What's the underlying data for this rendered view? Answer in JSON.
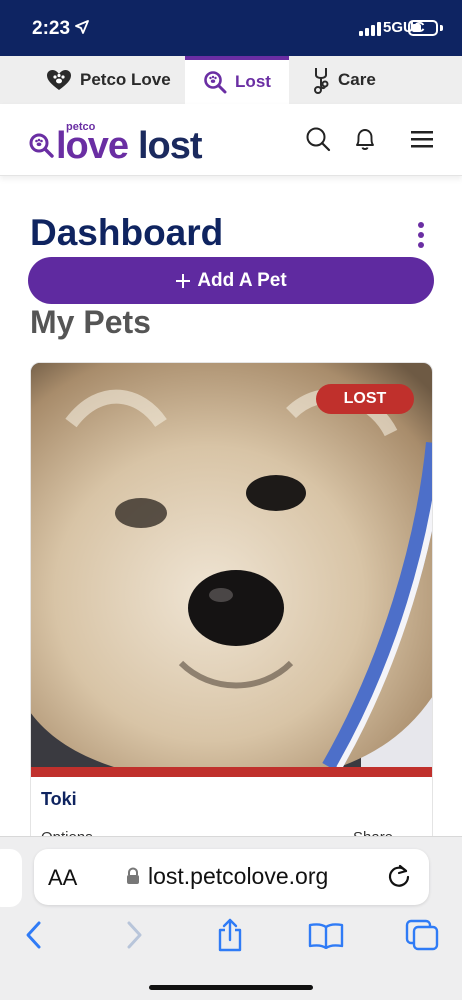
{
  "status_bar": {
    "time": "2:23",
    "network": "5GUC"
  },
  "brand_tabs": [
    {
      "label": "Petco Love",
      "icon": "heart-paw-icon",
      "active": false
    },
    {
      "label": "Lost",
      "icon": "magnifier-paw-icon",
      "active": true
    },
    {
      "label": "Care",
      "icon": "stethoscope-icon",
      "active": false
    }
  ],
  "header": {
    "logo_petco": "petco",
    "logo_love": "love",
    "logo_lost": "lost",
    "icons": [
      "search-icon",
      "bell-icon",
      "menu-icon"
    ]
  },
  "dashboard": {
    "title": "Dashboard",
    "add_pet_label": "Add A Pet",
    "section_title": "My Pets"
  },
  "pets": [
    {
      "name": "Toki",
      "status": "LOST",
      "options_label": "Options",
      "share_label": "Share"
    }
  ],
  "browser": {
    "aa_label": "AA",
    "url": "lost.petcolove.org",
    "toolbar_icons": [
      "back-icon",
      "forward-icon",
      "share-icon",
      "bookmarks-icon",
      "tabs-icon"
    ]
  },
  "colors": {
    "navy": "#0f2460",
    "purple": "#5f2aa0",
    "lost_red": "#c0302c",
    "ios_blue": "#2f7bf6"
  }
}
